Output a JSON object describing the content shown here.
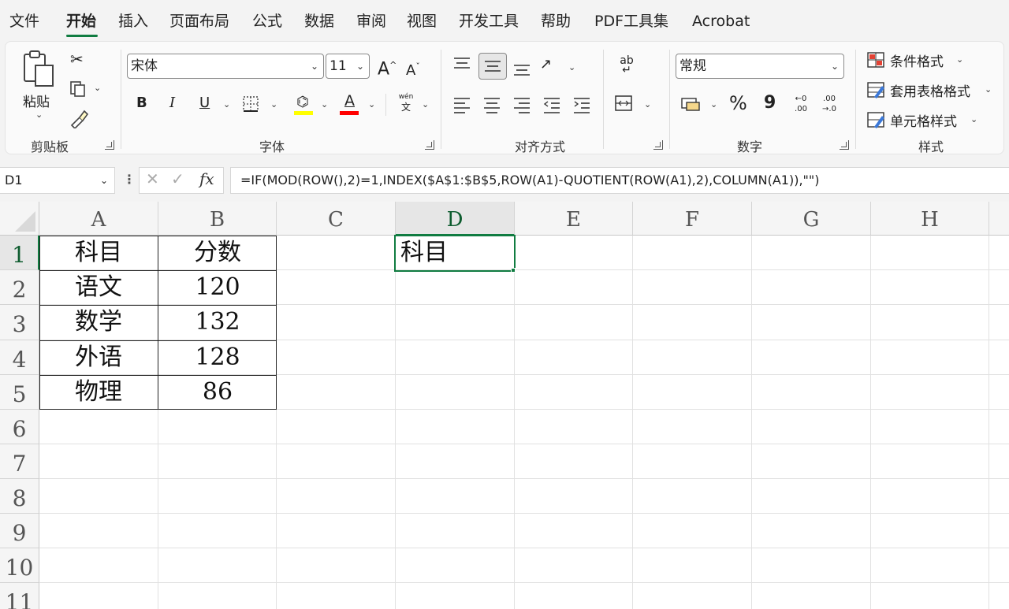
{
  "menu": {
    "tabs": [
      "文件",
      "开始",
      "插入",
      "页面布局",
      "公式",
      "数据",
      "审阅",
      "视图",
      "开发工具",
      "帮助",
      "PDF工具集",
      "Acrobat"
    ],
    "active_tab": "开始"
  },
  "ribbon": {
    "clipboard": {
      "paste_label": "粘贴",
      "group_label": "剪贴板"
    },
    "font": {
      "font_name": "宋体",
      "font_size": "11",
      "bold": "B",
      "italic": "I",
      "underline": "U",
      "phonetic": "wén",
      "phonetic_char": "文",
      "grow": "A",
      "shrink": "A",
      "font_color_letter": "A",
      "group_label": "字体",
      "fill_color": "#ffff00",
      "font_color": "#ff0000"
    },
    "alignment": {
      "group_label": "对齐方式",
      "wrap_label": "ab"
    },
    "number": {
      "format": "常规",
      "percent": "%",
      "comma": "9",
      "inc_decimal_top": "←0",
      "inc_decimal_bottom": ".00",
      "dec_decimal_top": ".00",
      "dec_decimal_bottom": "→.0",
      "group_label": "数字"
    },
    "styles": {
      "conditional": "条件格式",
      "table_format": "套用表格格式",
      "cell_styles": "单元格样式",
      "group_label": "样式"
    }
  },
  "formula_bar": {
    "name_box": "D1",
    "fx": "fx",
    "formula": "=IF(MOD(ROW(),2)=1,INDEX($A$1:$B$5,ROW(A1)-QUOTIENT(ROW(A1),2),COLUMN(A1)),\"\")"
  },
  "sheet": {
    "columns": [
      "A",
      "B",
      "C",
      "D",
      "E",
      "F",
      "G",
      "H"
    ],
    "selected_column": "D",
    "rows": [
      "1",
      "2",
      "3",
      "4",
      "5",
      "6",
      "7",
      "8",
      "9",
      "10",
      "11"
    ],
    "table": [
      [
        "科目",
        "分数"
      ],
      [
        "语文",
        "120"
      ],
      [
        "数学",
        "132"
      ],
      [
        "外语",
        "128"
      ],
      [
        "物理",
        "86"
      ]
    ],
    "d1_value": "科目",
    "accent": "#107c41"
  }
}
